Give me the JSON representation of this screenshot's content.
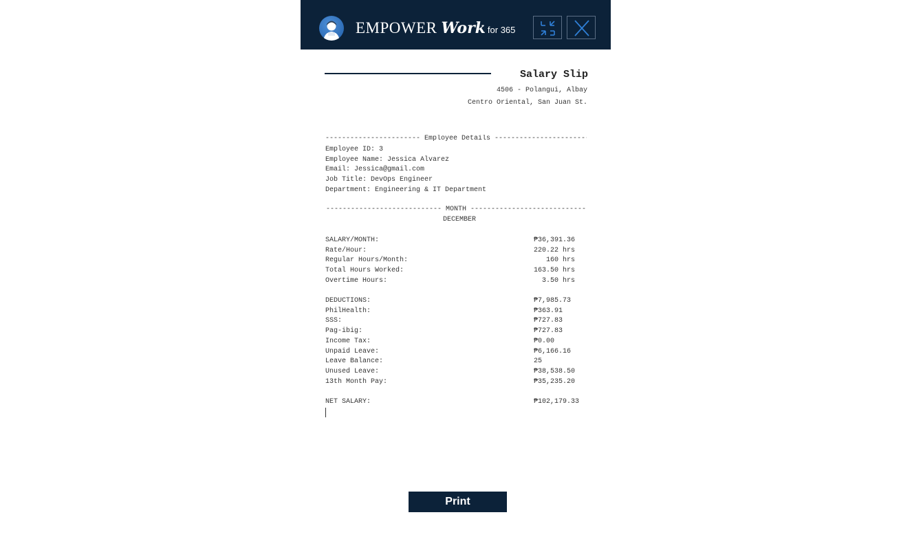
{
  "app": {
    "brand_main": "EMPOWER",
    "brand_work": "Work",
    "brand_for": "for 365"
  },
  "icons": {
    "avatar": "user-avatar-icon",
    "minimize": "minimize-arrows-icon",
    "close": "close-icon"
  },
  "colors": {
    "header_bg": "#0c2239",
    "accent": "#2f7fd6",
    "button_bg": "#0c2239"
  },
  "slip": {
    "title": "Salary Slip",
    "address_line1": "4506 - Polangui, Albay",
    "address_line2": "Centro Oriental, San Juan St.",
    "employee_divider": "----------------------- Employee Details -----------------------",
    "employee": {
      "id": "Employee ID: 3",
      "name": "Employee Name: Jessica Alvarez",
      "email": "Email: Jessica@gmail.com",
      "job_title": "Job Title: DevOps Engineer",
      "department": "Department: Engineering & IT Department"
    },
    "month_divider": "---------------------------- MONTH ----------------------------",
    "month": "DECEMBER",
    "earnings": [
      {
        "label": "SALARY/MONTH:",
        "value": "₱36,391.36"
      },
      {
        "label": "Rate/Hour:",
        "value": "220.22 hrs"
      },
      {
        "label": "Regular Hours/Month:",
        "value": "   160 hrs"
      },
      {
        "label": "Total Hours Worked:",
        "value": "163.50 hrs"
      },
      {
        "label": "Overtime Hours:",
        "value": "  3.50 hrs"
      }
    ],
    "deductions": [
      {
        "label": "DEDUCTIONS:",
        "value": "₱7,985.73"
      },
      {
        "label": "PhilHealth:",
        "value": "₱363.91"
      },
      {
        "label": "SSS:",
        "value": "₱727.83"
      },
      {
        "label": "Pag-ibig:",
        "value": "₱727.83"
      },
      {
        "label": "Income Tax:",
        "value": "₱0.00"
      },
      {
        "label": "Unpaid Leave:",
        "value": "₱6,166.16"
      },
      {
        "label": "Leave Balance:",
        "value": "25"
      },
      {
        "label": "Unused Leave:",
        "value": "₱38,538.50"
      },
      {
        "label": "13th Month Pay:",
        "value": "₱35,235.20"
      }
    ],
    "net": {
      "label": "NET SALARY:",
      "value": "₱102,179.33"
    }
  },
  "actions": {
    "print_label": "Print"
  }
}
